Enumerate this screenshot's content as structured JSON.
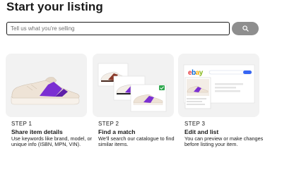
{
  "header": {
    "title": "Start your listing"
  },
  "search": {
    "placeholder": "Tell us what you're selling",
    "value": "",
    "button_icon": "search-icon"
  },
  "steps": [
    {
      "step": "STEP 1",
      "title": "Share item details",
      "description": "Use keywords like brand, model, or unique info (ISBN, MPN, VIN)."
    },
    {
      "step": "STEP 2",
      "title": "Find a match",
      "description": "We'll search our catalogue to find similar items."
    },
    {
      "step": "STEP 3",
      "title": "Edit and list",
      "description": "You can preview or make changes before listing your item."
    }
  ],
  "illustration": {
    "logo_text": "ebay"
  },
  "colors": {
    "card_bg": "#f2f2f2",
    "accent_purple": "#7b2fd2",
    "shoe_cream": "#eee3d6",
    "check_green": "#2fa84f",
    "search_btn": "#8e8e8e"
  }
}
